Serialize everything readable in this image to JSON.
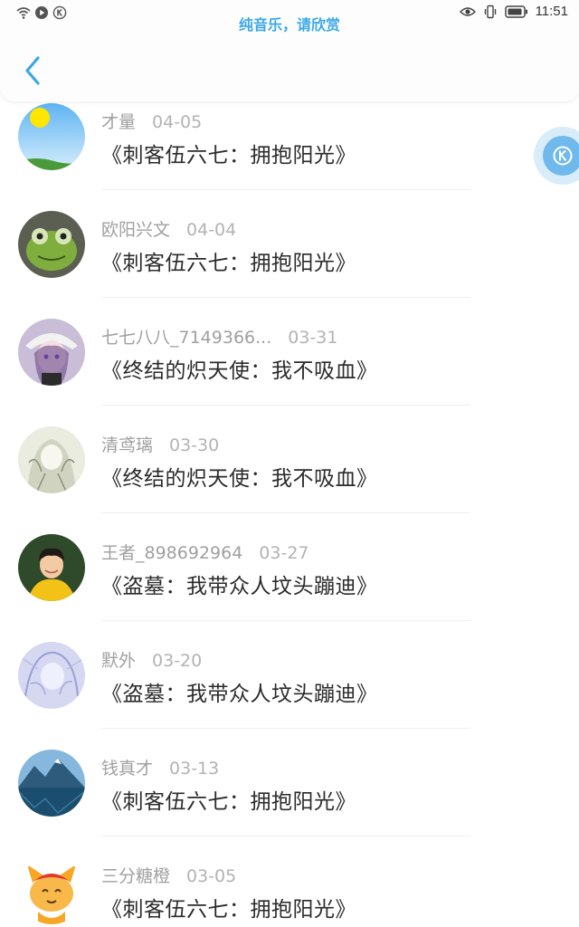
{
  "status_bar": {
    "time": "11:51",
    "left_icons": [
      "wifi-icon",
      "play-circle-icon",
      "k-circle-icon"
    ],
    "right_icons": [
      "eye-icon",
      "vibrate-icon",
      "battery-icon"
    ]
  },
  "header": {
    "title": "纯音乐，请欣赏",
    "back_icon": "chevron-left-icon"
  },
  "floating_button": {
    "icon": "k-badge-icon"
  },
  "colors": {
    "accent": "#39a8e6",
    "meta_text": "#a0a0a0",
    "primary_text": "#2b2b2b"
  },
  "items": [
    {
      "name": "才量",
      "date": "04-05",
      "song": "《刺客伍六七：拥抱阳光》",
      "avatar": "sky-sun"
    },
    {
      "name": "欧阳兴文",
      "date": "04-04",
      "song": "《刺客伍六七：拥抱阳光》",
      "avatar": "green-frog"
    },
    {
      "name": "七七八八_7149366...",
      "date": "03-31",
      "song": "《终结的炽天使：我不吸血》",
      "avatar": "anime-hat-purple"
    },
    {
      "name": "清鸢璃",
      "date": "03-30",
      "song": "《终结的炽天使：我不吸血》",
      "avatar": "anime-sketch"
    },
    {
      "name": "王者_898692964",
      "date": "03-27",
      "song": "《盗墓：我带众人坟头蹦迪》",
      "avatar": "boy-yellow-hoodie"
    },
    {
      "name": "默外",
      "date": "03-20",
      "song": "《盗墓：我带众人坟头蹦迪》",
      "avatar": "anime-lavender"
    },
    {
      "name": "钱真才",
      "date": "03-13",
      "song": "《刺客伍六七：拥抱阳光》",
      "avatar": "mountain-lake"
    },
    {
      "name": "三分糖橙",
      "date": "03-05",
      "song": "《刺客伍六七：拥抱阳光》",
      "avatar": "orange-cat"
    }
  ]
}
